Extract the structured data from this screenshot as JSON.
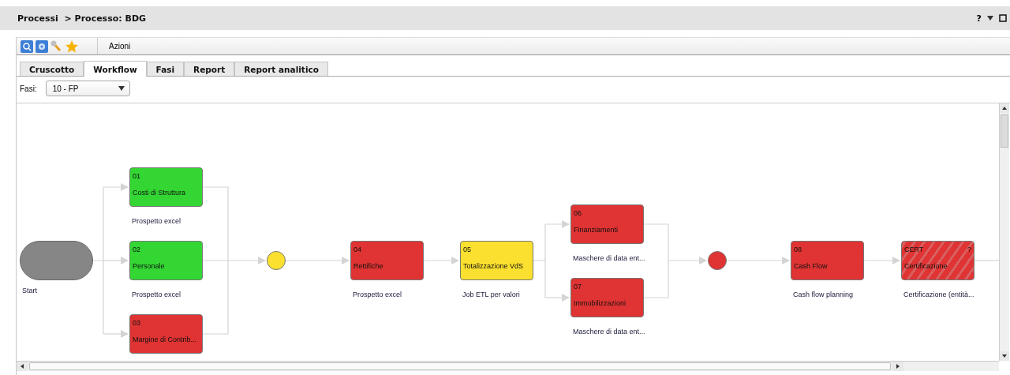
{
  "header": {
    "breadcrumb": "Processi  > Processo: BDG",
    "help": "?"
  },
  "toolbar": {
    "label": "Azioni"
  },
  "tabs": [
    {
      "label": "Cruscotto",
      "selected": false
    },
    {
      "label": "Workflow",
      "selected": true
    },
    {
      "label": "Fasi",
      "selected": false
    },
    {
      "label": "Report",
      "selected": false
    },
    {
      "label": "Report analitico",
      "selected": false
    }
  ],
  "filter": {
    "label": "Fasi:",
    "value": "10 - FP"
  },
  "workflow": {
    "nodes": [
      {
        "kind": "start",
        "caption": "Start"
      },
      {
        "kind": "task",
        "number": "01",
        "name": "Costi di Struttura",
        "caption": "Prospetto excel",
        "color": "#33d633",
        "hatched": false
      },
      {
        "kind": "task",
        "number": "02",
        "name": "Personale",
        "caption": "Prospetto excel",
        "color": "#33d633",
        "hatched": false
      },
      {
        "kind": "task",
        "number": "03",
        "name": "Margine di Contrib...",
        "color": "#e03333",
        "hatched": false
      },
      {
        "kind": "gateway",
        "color": "#fbe02f"
      },
      {
        "kind": "task",
        "number": "04",
        "name": "Rettifiche",
        "caption": "Prospetto excel",
        "color": "#e03333",
        "hatched": false
      },
      {
        "kind": "task",
        "number": "05",
        "name": "Totalizzazione VdS",
        "caption": "Job ETL per valori",
        "color": "#fbe02f",
        "hatched": false
      },
      {
        "kind": "task",
        "number": "06",
        "name": "Finanziamenti",
        "caption": "Maschere di data ent...",
        "color": "#e03333",
        "hatched": false
      },
      {
        "kind": "task",
        "number": "07",
        "name": "Immobilizzazioni",
        "caption": "Maschere di data ent...",
        "color": "#e03333",
        "hatched": false
      },
      {
        "kind": "gateway",
        "color": "#e03333"
      },
      {
        "kind": "task",
        "number": "08",
        "name": "Cash Flow",
        "caption": "Cash flow planning",
        "color": "#e03333",
        "hatched": false
      },
      {
        "kind": "task",
        "number": "CERT",
        "name": "Certificazione",
        "caption": "Certificazione (entità...",
        "color": "#e03333",
        "hatched": true,
        "help": "?"
      }
    ]
  }
}
